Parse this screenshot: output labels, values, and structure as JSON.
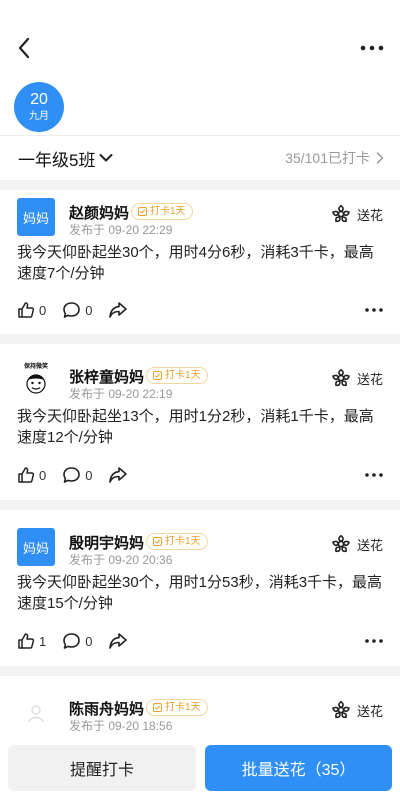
{
  "date": {
    "day": "20",
    "month": "九月"
  },
  "class_selector": {
    "name": "一年级5班"
  },
  "checkin_summary": {
    "text": "35/101已打卡"
  },
  "posts": [
    {
      "author": "赵颜妈妈",
      "avatar_text": "妈妈",
      "badge": "打卡1天",
      "time": "发布于 09-20 22:29",
      "content": "我今天仰卧起坐30个，用时4分6秒，消耗3千卡，最高速度7个/分钟",
      "likes": "0",
      "comments": "0",
      "flower_label": "送花"
    },
    {
      "author": "张梓童妈妈",
      "avatar_text": "保持微笑",
      "badge": "打卡1天",
      "time": "发布于 09-20 22:19",
      "content": "我今天仰卧起坐13个，用时1分2秒，消耗1千卡，最高速度12个/分钟",
      "likes": "0",
      "comments": "0",
      "flower_label": "送花"
    },
    {
      "author": "殷明宇妈妈",
      "avatar_text": "妈妈",
      "badge": "打卡1天",
      "time": "发布于 09-20 20:36",
      "content": "我今天仰卧起坐30个，用时1分53秒，消耗3千卡，最高速度15个/分钟",
      "likes": "1",
      "comments": "0",
      "flower_label": "送花"
    },
    {
      "author": "陈雨舟妈妈",
      "badge": "打卡1天",
      "time": "发布于 09-20 18:56",
      "flower_label": "送花"
    }
  ],
  "bottom": {
    "remind_label": "提醒打卡",
    "batch_label": "批量送花（35）"
  },
  "colors": {
    "accent": "#2f8ff5",
    "badge": "#e6a02b"
  }
}
